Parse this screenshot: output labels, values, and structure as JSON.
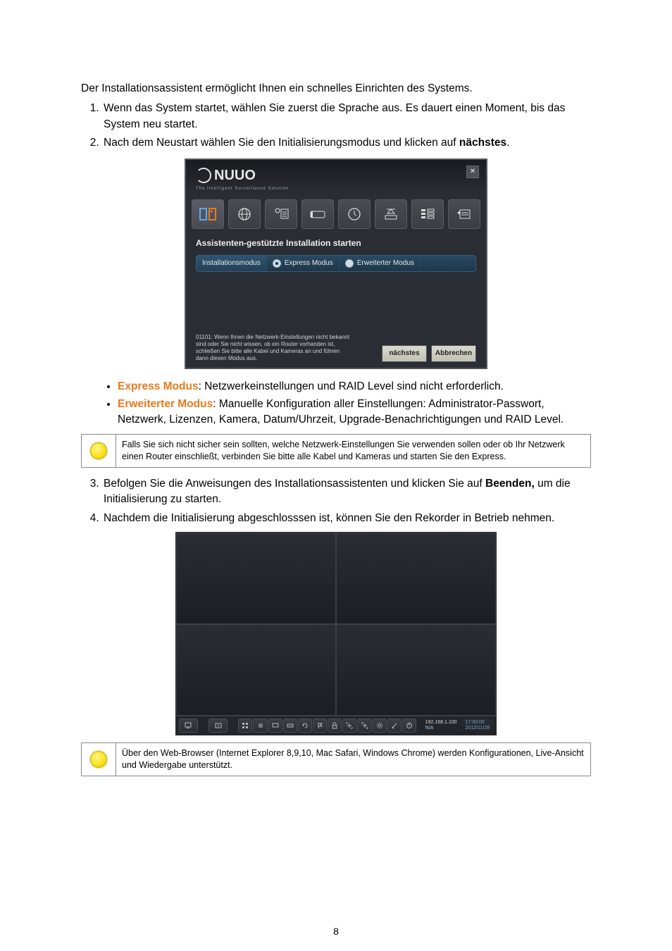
{
  "intro": "Der Installationsassistent ermöglicht Ihnen ein schnelles Einrichten des Systems.",
  "steps": {
    "s1": "Wenn das System startet, wählen Sie zuerst die Sprache aus. Es dauert einen Moment, bis das System neu startet.",
    "s2_pre": "Nach dem Neustart wählen Sie den Initialisierungsmodus und klicken auf ",
    "s2_bold": "nächstes",
    "s2_post": ".",
    "s3_pre": "Befolgen Sie die Anweisungen des Installationsassistenten und klicken Sie auf ",
    "s3_bold": "Beenden,",
    "s3_post": " um die Initialisierung zu starten.",
    "s4": "Nachdem die Initialisierung abgeschlosssen ist, können Sie den Rekorder in Betrieb nehmen."
  },
  "wizard": {
    "brand": "NUUO",
    "subbrand": "The Intelligent Surveillance Solution",
    "title": "Assistenten-gestützte Installation starten",
    "tab_label": "Installationsmodus",
    "radio1": "Express Modus",
    "radio2": "Erweiterter Modus",
    "hint": "01101: Wenn Ihnen die Netzwerk-Einstellungen nicht bekannt sind oder Sie nicht wissen, ob ein Router vorhanden ist, schließen Sie bitte alle Kabel und Kameras an und führen dann diesen Modus aus.",
    "btn_next": "nächstes",
    "btn_cancel": "Abbrechen"
  },
  "bullets": {
    "express_label": "Express Modus",
    "express_text": ": Netzwerkeinstellungen und RAID Level sind nicht erforderlich.",
    "adv_label": "Erweiterter Modus",
    "adv_text": ": Manuelle Konfiguration aller Einstellungen: Administrator-Passwort, Netzwerk, Lizenzen, Kamera, Datum/Uhrzeit, Upgrade-Benachrichtigungen und RAID Level."
  },
  "note1": "Falls Sie sich nicht sicher sein sollten, welche Netzwerk-Einstellungen Sie verwenden sollen oder ob Ihr Netzwerk einen Router einschließt, verbinden Sie bitte alle Kabel und Kameras und starten Sie den Express.",
  "note2": "Über den Web-Browser (Internet Explorer 8,9,10, Mac Safari, Windows Chrome) werden Konfigurationen, Live-Ansicht und Wiedergabe unterstützt.",
  "recorder": {
    "ip": "192.168.1.100",
    "na": "N/A",
    "time": "17:00:00",
    "date": "2012/11/28"
  },
  "page_number": "8"
}
